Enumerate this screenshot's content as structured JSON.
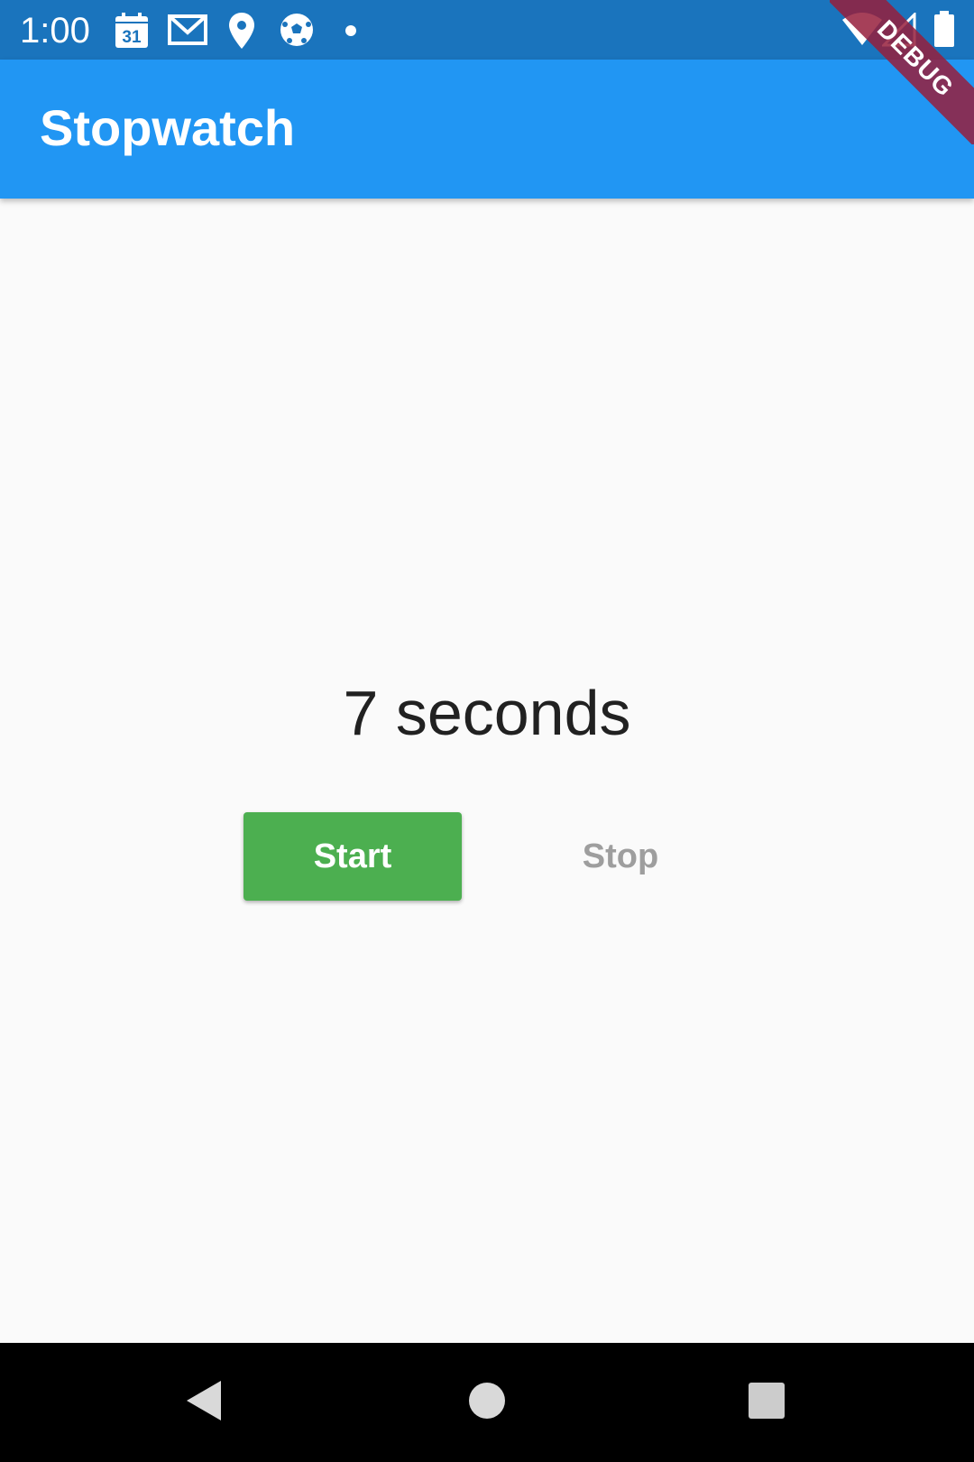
{
  "status_bar": {
    "time": "1:00",
    "calendar_day": "31",
    "icons": [
      "calendar-icon",
      "gmail-icon",
      "location-pin-icon",
      "soccer-ball-icon",
      "notification-dot-icon",
      "wifi-icon",
      "cell-signal-icon",
      "battery-icon"
    ]
  },
  "app_bar": {
    "title": "Stopwatch",
    "color": "#2196f3"
  },
  "debug_banner": {
    "label": "DEBUG"
  },
  "main": {
    "elapsed_text": "7 seconds",
    "start_label": "Start",
    "stop_label": "Stop",
    "start_color": "#4caf50",
    "stop_color": "#9e9e9e"
  },
  "nav_bar": {
    "icons": [
      "back-icon",
      "home-icon",
      "recents-icon"
    ]
  }
}
